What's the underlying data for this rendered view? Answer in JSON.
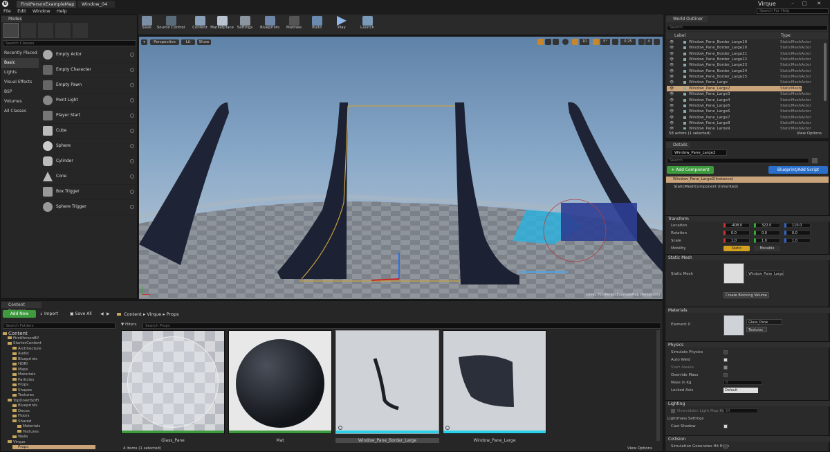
{
  "window": {
    "doc_tabs": [
      "FirstPersonExampleMap",
      "Window_04"
    ],
    "project_name": "Virque",
    "search_help": "Search For Help"
  },
  "menu": [
    "File",
    "Edit",
    "Window",
    "Help"
  ],
  "modes": {
    "tab": "Modes",
    "search_placeholder": "Search Classes",
    "categories": [
      "Recently Placed",
      "Basic",
      "Lights",
      "Visual Effects",
      "BSP",
      "Volumes",
      "All Classes"
    ],
    "selected_category": "Basic",
    "items": [
      "Empty Actor",
      "Empty Character",
      "Empty Pawn",
      "Point Light",
      "Player Start",
      "Cube",
      "Sphere",
      "Cylinder",
      "Cone",
      "Box Trigger",
      "Sphere Trigger"
    ]
  },
  "toolbar": {
    "buttons": [
      "Save",
      "Source Control",
      "Content",
      "Marketplace",
      "Settings",
      "Blueprints",
      "Matinee",
      "Build",
      "Play",
      "Launch"
    ]
  },
  "viewport": {
    "view_mode": "Perspective",
    "lighting": "Lit",
    "show": "Show",
    "grid_value": "10",
    "angle_value": "5°",
    "scale_value": "0.25",
    "camera_speed": "4",
    "level_label": "Level: FirstPersonExampleMap (Persistent)"
  },
  "outliner": {
    "tab": "World Outliner",
    "search_placeholder": "Search",
    "col_label": "Label",
    "col_type": "Type",
    "rows": [
      {
        "label": "Window_Pane_Border_Large19",
        "type": "StaticMeshActor"
      },
      {
        "label": "Window_Pane_Border_Large20",
        "type": "StaticMeshActor"
      },
      {
        "label": "Window_Pane_Border_Large21",
        "type": "StaticMeshActor"
      },
      {
        "label": "Window_Pane_Border_Large22",
        "type": "StaticMeshActor"
      },
      {
        "label": "Window_Pane_Border_Large23",
        "type": "StaticMeshActor"
      },
      {
        "label": "Window_Pane_Border_Large24",
        "type": "StaticMeshActor"
      },
      {
        "label": "Window_Pane_Border_Large25",
        "type": "StaticMeshActor"
      },
      {
        "label": "Window_Pane_Large",
        "type": "StaticMeshActor"
      },
      {
        "label": "Window_Pane_Large2",
        "type": "StaticMeshActor"
      },
      {
        "label": "Window_Pane_Large3",
        "type": "StaticMeshActor"
      },
      {
        "label": "Window_Pane_Large4",
        "type": "StaticMeshActor"
      },
      {
        "label": "Window_Pane_Large5",
        "type": "StaticMeshActor"
      },
      {
        "label": "Window_Pane_Large6",
        "type": "StaticMeshActor"
      },
      {
        "label": "Window_Pane_Large7",
        "type": "StaticMeshActor"
      },
      {
        "label": "Window_Pane_Large8",
        "type": "StaticMeshActor"
      },
      {
        "label": "Window_Pane_Large9",
        "type": "StaticMeshActor"
      }
    ],
    "selected_index": 8,
    "status": "58 actors (1 selected)",
    "view_options": "View Options"
  },
  "details": {
    "tab": "Details",
    "name_value": "Window_Pane_Large2",
    "search_placeholder": "Search",
    "add_component": "+ Add Component",
    "blueprint_script": "Blueprint/Add Script",
    "instance": "Window_Pane_Large2(Instance)",
    "component": "StaticMeshComponent (Inherited)",
    "transform": {
      "title": "Transform",
      "location_label": "Location",
      "rotation_label": "Rotation",
      "scale_label": "Scale",
      "mobility_label": "Mobility",
      "location": [
        "-408.0",
        "322.0",
        "110.0"
      ],
      "rotation": [
        "0.0",
        "0.0",
        "0.0"
      ],
      "scale": [
        "1.0",
        "1.0",
        "1.0"
      ],
      "mobility_static": "Static",
      "mobility_movable": "Movable"
    },
    "static_mesh": {
      "title": "Static Mesh",
      "label": "Static Mesh",
      "value": "Window_Pane_Large",
      "blocking_button": "Create Blocking Volume"
    },
    "materials": {
      "title": "Materials",
      "element_label": "Element 0",
      "value": "Glass_Pane",
      "textures": "Textures"
    },
    "physics": {
      "title": "Physics",
      "rows": [
        "Simulate Physics",
        "Auto Weld",
        "Start Awake",
        "Override Mass",
        "Mass in Kg",
        "Locked Axis"
      ],
      "mass_value": "0",
      "locked_axis_value": "Default"
    },
    "lighting": {
      "title": "Lighting",
      "override": "Overridden Light Map Res",
      "override_value": "64",
      "lightmass": "Lightmass Settings",
      "cast_shadow": "Cast Shadow"
    },
    "collision": {
      "title": "Collision",
      "row": "Simulation Generates Hit Even"
    }
  },
  "content_browser": {
    "tab": "Content Browser",
    "add_new": "Add New",
    "import": "Import",
    "save_all": "Save All",
    "path": [
      "Content",
      "Virque",
      "Props"
    ],
    "search_folders": "Search Folders",
    "filters": "Filters",
    "search_props": "Search Props",
    "tree": [
      {
        "name": "Content",
        "depth": 0
      },
      {
        "name": "FirstPersonBP",
        "depth": 1
      },
      {
        "name": "StarterContent",
        "depth": 1
      },
      {
        "name": "Architecture",
        "depth": 2
      },
      {
        "name": "Audio",
        "depth": 2
      },
      {
        "name": "Blueprints",
        "depth": 2
      },
      {
        "name": "HDRI",
        "depth": 2
      },
      {
        "name": "Maps",
        "depth": 2
      },
      {
        "name": "Materials",
        "depth": 2
      },
      {
        "name": "Particles",
        "depth": 2
      },
      {
        "name": "Props",
        "depth": 2
      },
      {
        "name": "Shapes",
        "depth": 2
      },
      {
        "name": "Textures",
        "depth": 2
      },
      {
        "name": "TopDownSciFi",
        "depth": 1
      },
      {
        "name": "Blueprints",
        "depth": 2
      },
      {
        "name": "Decos",
        "depth": 2
      },
      {
        "name": "Floors",
        "depth": 2
      },
      {
        "name": "Shared",
        "depth": 2
      },
      {
        "name": "Materials",
        "depth": 3
      },
      {
        "name": "Textures",
        "depth": 3
      },
      {
        "name": "Walls",
        "depth": 2
      },
      {
        "name": "Virque",
        "depth": 1
      },
      {
        "name": "Props",
        "depth": 2
      }
    ],
    "assets": [
      "Glass_Pane",
      "Mat",
      "Window_Pane_Border_Large",
      "Window_Pane_Large"
    ],
    "status": "4 items (1 selected)",
    "view_options": "View Options"
  },
  "colors": {
    "accent_green": "#3d9a3d",
    "accent_blue": "#2a6fc9",
    "selection": "#c9a37a"
  }
}
